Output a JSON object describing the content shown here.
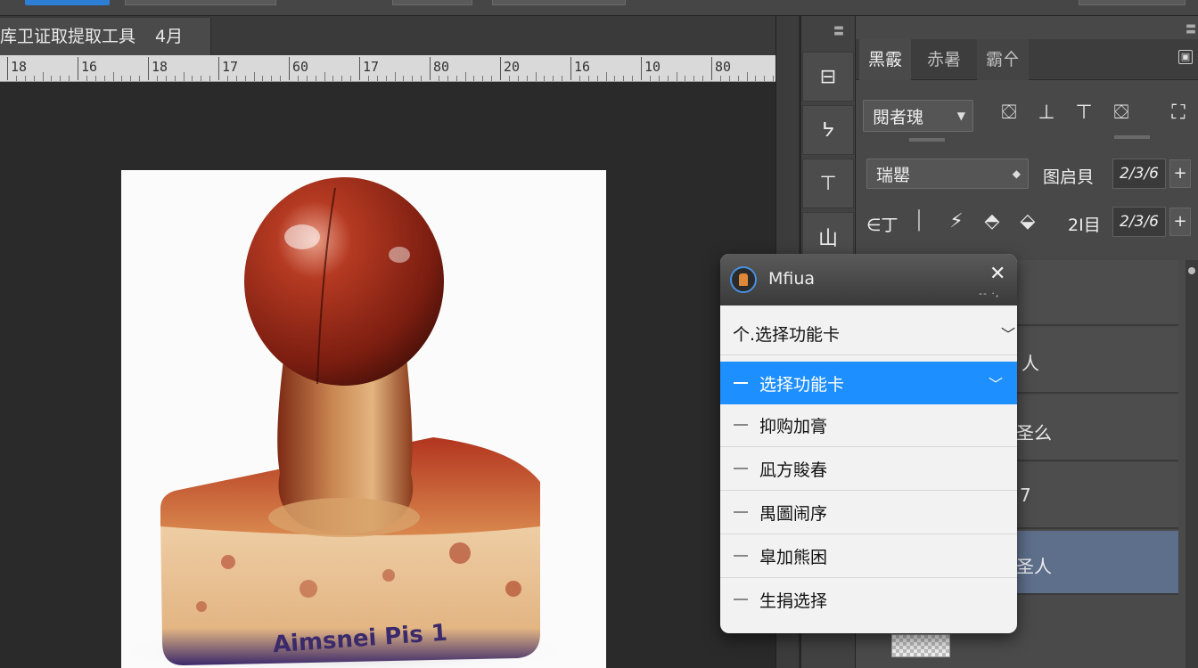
{
  "document": {
    "tab_title": "库卫证取提取工具",
    "tab_zoom": "4月"
  },
  "ruler": {
    "labels": [
      "18",
      "16",
      "18",
      "17",
      "60",
      "17",
      "80",
      "20",
      "16",
      "10",
      "80"
    ]
  },
  "image": {
    "stamp_text": "Aimsnei Pis 1",
    "colors": {
      "handle": "#a3321c",
      "base": "#e8c39a",
      "ink": "#3b2a6b"
    }
  },
  "toolstrip": {
    "tools": [
      {
        "icon": "grid-icon",
        "glyph": "⊟"
      },
      {
        "icon": "lasso-icon",
        "glyph": "ᔭ"
      },
      {
        "icon": "crop-icon",
        "glyph": "⊤"
      },
      {
        "icon": "layers-icon",
        "glyph": "山"
      }
    ]
  },
  "panel": {
    "tabs": [
      "黑霰",
      "赤暑",
      "霸㐃"
    ],
    "preset_dropdown": "閱者瑰",
    "align_icons": [
      "⛋",
      "⊥",
      "⊤",
      "⛋",
      "⛶"
    ],
    "mode_dropdown": "瑞罌",
    "mode_label": "图启貝",
    "mode_value": "2/3/6",
    "row3_label": "∈丁",
    "row3_right_label": "2Ⅰ目",
    "row3_value": "2/3/6",
    "layers": [
      {
        "name": ""
      },
      {
        "name": "人"
      },
      {
        "name": "圣么"
      },
      {
        "name": "7"
      },
      {
        "name": "圣人"
      }
    ]
  },
  "popup": {
    "title": "Mfiua",
    "subtitle": "-- ·,",
    "close": "✕",
    "header_item": "个.选择功能卡",
    "items": [
      {
        "label": "选择功能卡",
        "highlighted": true
      },
      {
        "label": "抑购加膏",
        "highlighted": false
      },
      {
        "label": "凪方賐春",
        "highlighted": false
      },
      {
        "label": "禺圖闹序",
        "highlighted": false
      },
      {
        "label": "皐加熊困",
        "highlighted": false
      },
      {
        "label": "生捐选择",
        "highlighted": false
      }
    ],
    "accent": "#1e8fff"
  }
}
